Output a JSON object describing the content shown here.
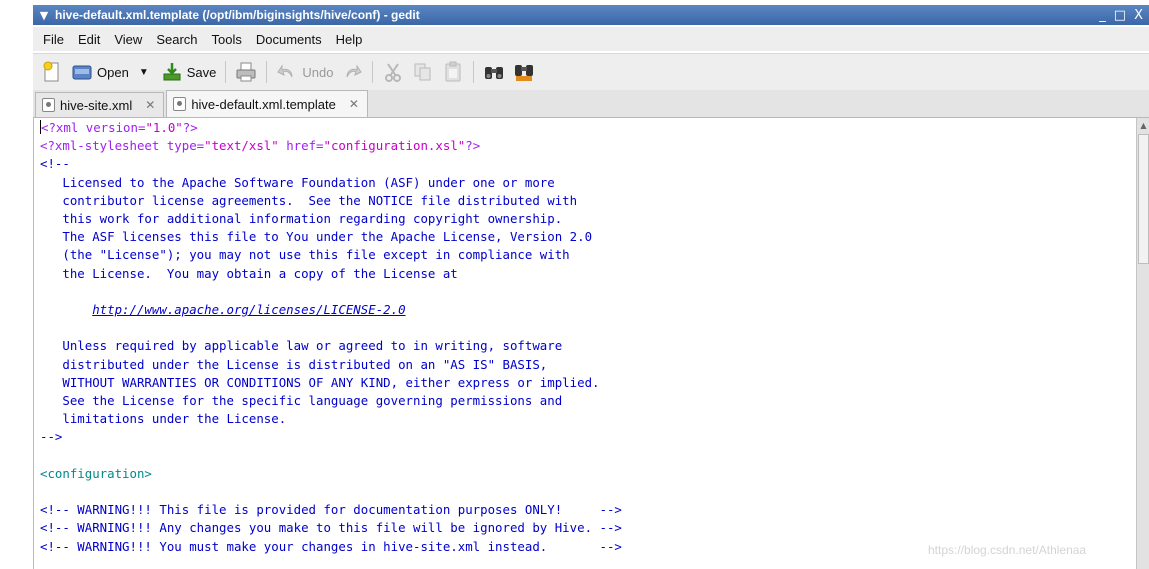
{
  "window": {
    "title": "hive-default.xml.template (/opt/ibm/biginsights/hive/conf) - gedit",
    "menu_arrow": "▼",
    "minimize": "_",
    "maximize": "□",
    "close": "X"
  },
  "menu": [
    "File",
    "Edit",
    "View",
    "Search",
    "Tools",
    "Documents",
    "Help"
  ],
  "toolbar": {
    "open_label": "Open",
    "save_label": "Save",
    "undo_label": "Undo"
  },
  "tabs": [
    {
      "label": "hive-site.xml",
      "active": false
    },
    {
      "label": "hive-default.xml.template",
      "active": true
    }
  ],
  "editor": {
    "xml_decl_start": "<?xml version=",
    "xml_decl_val": "\"1.0\"",
    "xml_decl_end": "?>",
    "stylesheet_start": "<?xml-stylesheet type=",
    "stylesheet_type": "\"text/xsl\"",
    "stylesheet_mid": " href=",
    "stylesheet_href": "\"configuration.xsl\"",
    "stylesheet_end": "?>",
    "comment_open": "<!--",
    "license_lines": [
      "   Licensed to the Apache Software Foundation (ASF) under one or more",
      "   contributor license agreements.  See the NOTICE file distributed with",
      "   this work for additional information regarding copyright ownership.",
      "   The ASF licenses this file to You under the Apache License, Version 2.0",
      "   (the \"License\"); you may not use this file except in compliance with",
      "   the License.  You may obtain a copy of the License at"
    ],
    "license_url": "http://www.apache.org/licenses/LICENSE-2.0",
    "license_lines_2": [
      "   Unless required by applicable law or agreed to in writing, software",
      "   distributed under the License is distributed on an \"AS IS\" BASIS,",
      "   WITHOUT WARRANTIES OR CONDITIONS OF ANY KIND, either express or implied.",
      "   See the License for the specific language governing permissions and",
      "   limitations under the License."
    ],
    "comment_close": "-->",
    "configuration_tag": "<configuration>",
    "warnings": [
      "<!-- WARNING!!! This file is provided for documentation purposes ONLY!     -->",
      "<!-- WARNING!!! Any changes you make to this file will be ignored by Hive. -->",
      "<!-- WARNING!!! You must make your changes in hive-site.xml instead.       -->"
    ]
  },
  "watermark": "https://blog.csdn.net/Athlenaa"
}
